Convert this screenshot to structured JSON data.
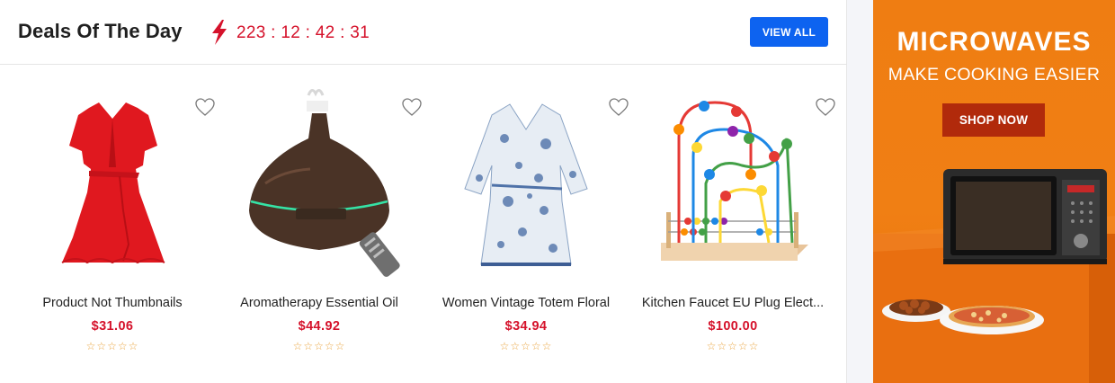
{
  "deals": {
    "title": "Deals Of The Day",
    "countdown": "223 : 12 : 42 : 31",
    "view_all_label": "VIEW ALL",
    "icons": {
      "countdown": "lightning-bolt-icon",
      "wishlist": "heart-outline-icon",
      "rating": "star-outline-icon"
    },
    "products": [
      {
        "name": "Product Not Thumbnails",
        "price": "$31.06",
        "rating": 0,
        "image": "red-dress"
      },
      {
        "name": "Aromatherapy Essential Oil",
        "price": "$44.92",
        "rating": 0,
        "image": "aroma-diffuser"
      },
      {
        "name": "Women Vintage Totem Floral",
        "price": "$34.94",
        "rating": 0,
        "image": "floral-robe"
      },
      {
        "name": "Kitchen Faucet EU Plug Elect...",
        "price": "$100.00",
        "rating": 0,
        "image": "bead-maze-toy"
      }
    ]
  },
  "ad": {
    "title": "MICROWAVES",
    "subtitle": "MAKE COOKING EASIER",
    "button_label": "SHOP NOW"
  },
  "colors": {
    "accent_red": "#d5122b",
    "button_blue": "#0d63f0",
    "ad_orange": "#f07f14",
    "ad_button": "#b12a0b",
    "star": "#e9a23b"
  }
}
